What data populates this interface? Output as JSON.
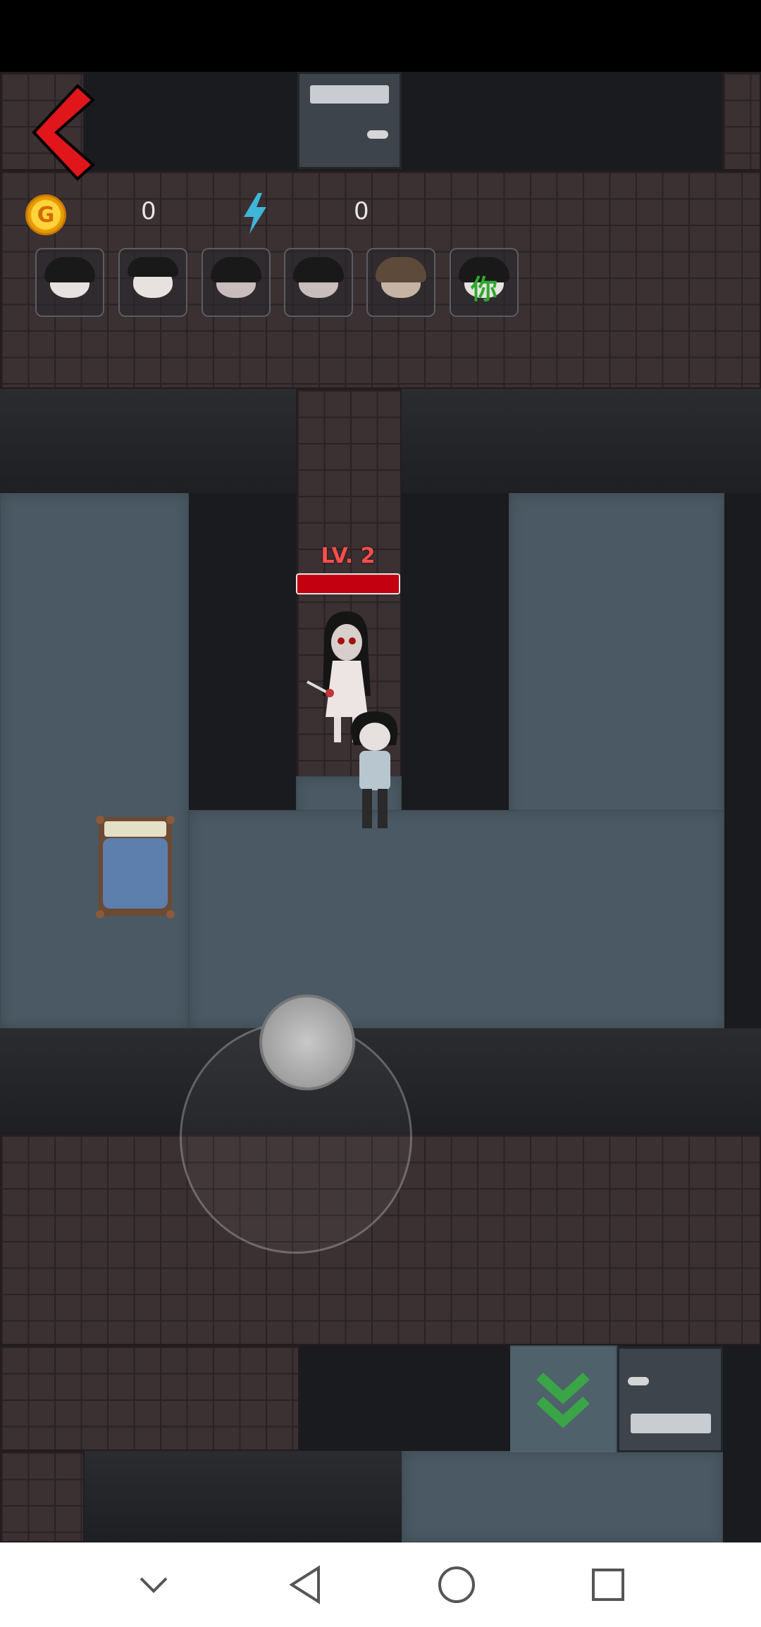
{
  "hud": {
    "coin_icon_label": "G",
    "gold_value": "0",
    "energy_value": "0",
    "ghost_slot_label": "你"
  },
  "monster": {
    "level_label": "LV. 2",
    "health_fraction": 1.0
  },
  "icons": {
    "back": "back-chevron-icon",
    "coin": "gold-coin-icon",
    "energy": "lightning-icon",
    "exit": "double-chevron-down-icon",
    "nav_recent": "chevron-down-icon",
    "nav_back": "triangle-back-icon",
    "nav_home": "circle-home-icon",
    "nav_overview": "square-overview-icon"
  },
  "colors": {
    "back_arrow": "#e0161b",
    "hp_bar": "#c30010",
    "level_text": "#ff4d4d",
    "exit_arrow": "#3aa547",
    "slot_label": "#2ea82e"
  }
}
